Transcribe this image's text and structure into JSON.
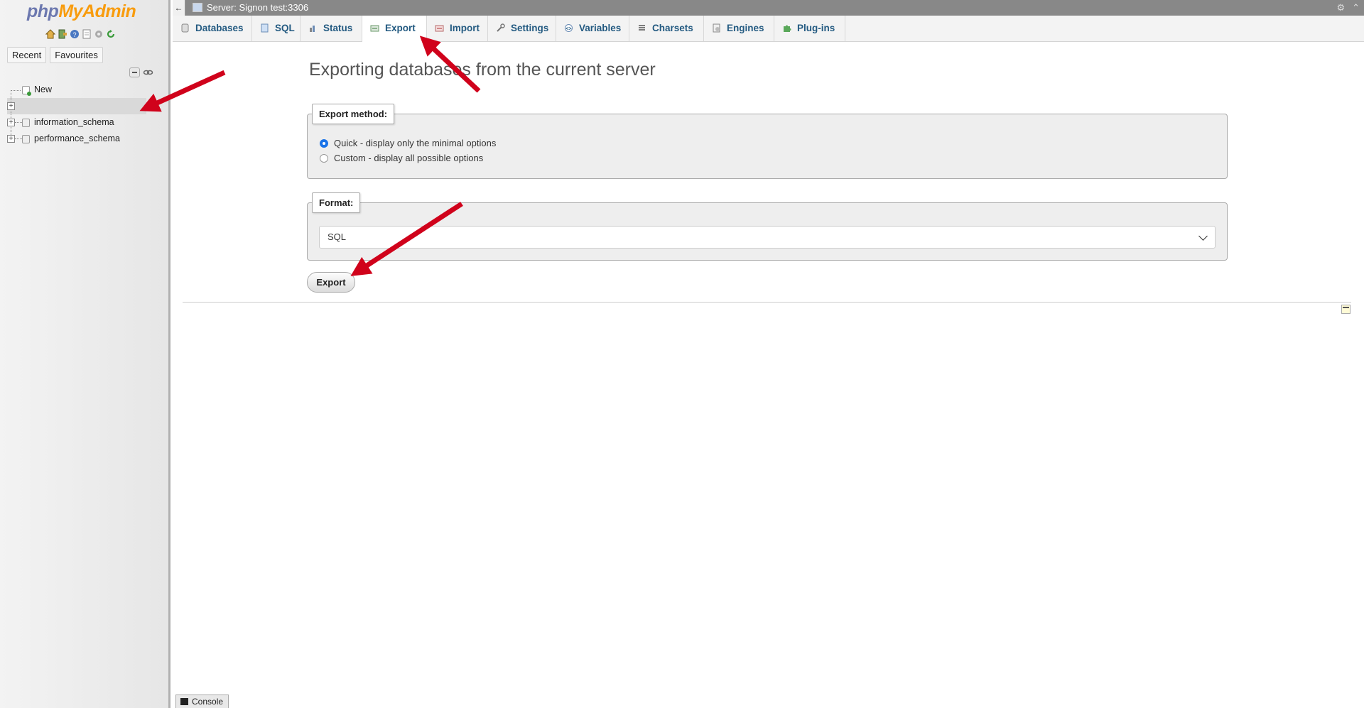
{
  "nav": {
    "logo_php": "php",
    "logo_myadmin": "MyAdmin",
    "icons": [
      "home-icon",
      "logout-icon",
      "help-icon",
      "docs-icon",
      "settings-icon",
      "reload-icon"
    ],
    "tabs": [
      "Recent",
      "Favourites"
    ],
    "tree": {
      "new_label": "New",
      "items": [
        "",
        "information_schema",
        "performance_schema"
      ]
    }
  },
  "topbar": {
    "server_label": "Server: Signon test:3306"
  },
  "menu": {
    "tabs": [
      {
        "label": "Databases",
        "icon": "databases-icon"
      },
      {
        "label": "SQL",
        "icon": "sql-icon"
      },
      {
        "label": "Status",
        "icon": "status-icon"
      },
      {
        "label": "Export",
        "icon": "export-icon",
        "active": true
      },
      {
        "label": "Import",
        "icon": "import-icon"
      },
      {
        "label": "Settings",
        "icon": "settings-icon"
      },
      {
        "label": "Variables",
        "icon": "variables-icon"
      },
      {
        "label": "Charsets",
        "icon": "charsets-icon"
      },
      {
        "label": "Engines",
        "icon": "engines-icon"
      },
      {
        "label": "Plug-ins",
        "icon": "plugins-icon"
      }
    ]
  },
  "main": {
    "heading": "Exporting databases from the current server",
    "export_method": {
      "legend": "Export method:",
      "options": [
        {
          "label": "Quick - display only the minimal options",
          "checked": true
        },
        {
          "label": "Custom - display all possible options",
          "checked": false
        }
      ]
    },
    "format": {
      "legend": "Format:",
      "selected": "SQL"
    },
    "export_button": "Export"
  },
  "console": {
    "label": "Console"
  },
  "colors": {
    "menu_link": "#235a81",
    "annotation_arrow": "#d0021b",
    "topbar": "#888888"
  }
}
